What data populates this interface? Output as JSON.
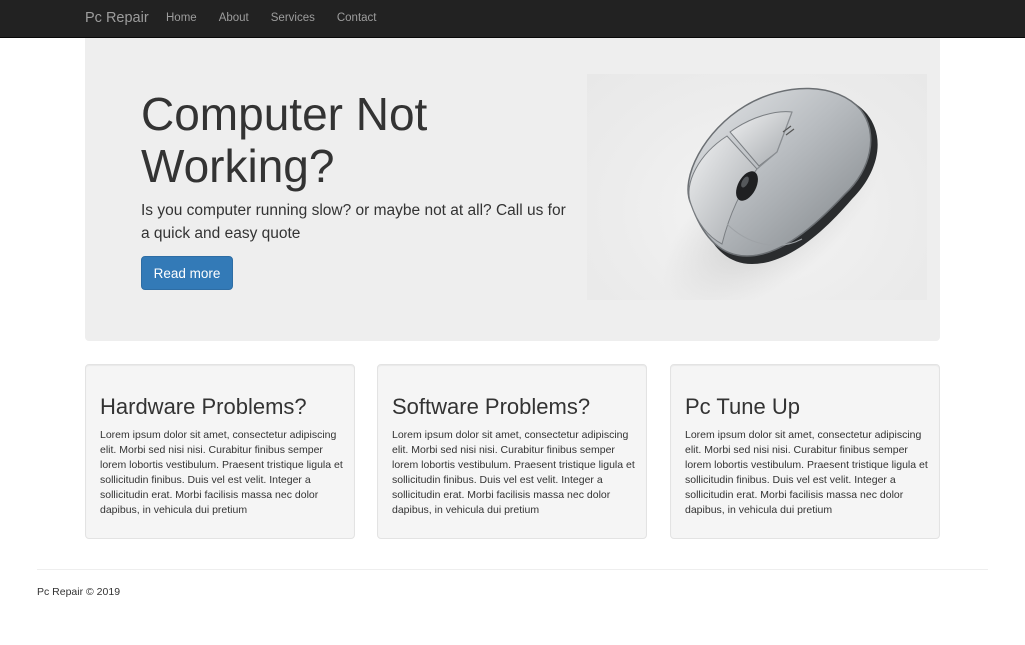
{
  "navbar": {
    "brand": "Pc Repair",
    "links": [
      {
        "label": "Home"
      },
      {
        "label": "About"
      },
      {
        "label": "Services"
      },
      {
        "label": "Contact"
      }
    ]
  },
  "hero": {
    "title": "Computer Not Working?",
    "text": "Is you computer running slow? or maybe not at all? Call us for a quick and easy quote",
    "button_label": "Read more",
    "image_icon": "computer-mouse-icon"
  },
  "cards": [
    {
      "title": "Hardware Problems?",
      "text": "Lorem ipsum dolor sit amet, consectetur adipiscing elit. Morbi sed nisi nisi. Curabitur finibus semper lorem lobortis vestibulum. Praesent tristique ligula et sollicitudin finibus. Duis vel est velit. Integer a sollicitudin erat. Morbi facilisis massa nec dolor dapibus, in vehicula dui pretium"
    },
    {
      "title": "Software Problems?",
      "text": "Lorem ipsum dolor sit amet, consectetur adipiscing elit. Morbi sed nisi nisi. Curabitur finibus semper lorem lobortis vestibulum. Praesent tristique ligula et sollicitudin finibus. Duis vel est velit. Integer a sollicitudin erat. Morbi facilisis massa nec dolor dapibus, in vehicula dui pretium"
    },
    {
      "title": "Pc Tune Up",
      "text": "Lorem ipsum dolor sit amet, consectetur adipiscing elit. Morbi sed nisi nisi. Curabitur finibus semper lorem lobortis vestibulum. Praesent tristique ligula et sollicitudin finibus. Duis vel est velit. Integer a sollicitudin erat. Morbi facilisis massa nec dolor dapibus, in vehicula dui pretium"
    }
  ],
  "footer": {
    "text": "Pc Repair © 2019"
  },
  "colors": {
    "navbar_bg": "#222222",
    "nav_text": "#9d9d9d",
    "hero_bg": "#eeeeee",
    "primary": "#337ab7",
    "card_bg": "#f5f5f5"
  }
}
